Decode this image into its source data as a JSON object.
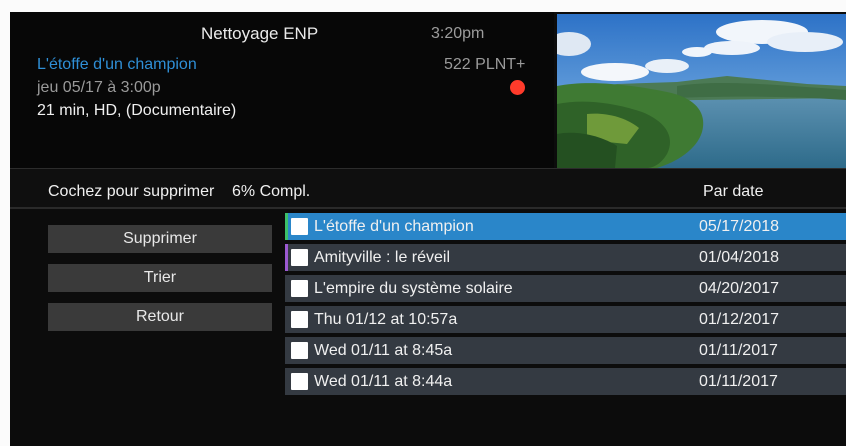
{
  "header": {
    "title": "Nettoyage ENP",
    "time": "3:20pm"
  },
  "program": {
    "title": "L'étoffe d'un champion",
    "airing": "jeu 05/17 à 3:00p",
    "details": "21 min, HD, (Documentaire)",
    "channel": "522 PLNT+",
    "recording_indicator_color": "#ff3b2b"
  },
  "status": {
    "instruction": "Cochez pour supprimer",
    "completion": "6% Compl.",
    "sort": "Par date"
  },
  "menu": {
    "delete_label": "Supprimer",
    "sort_label": "Trier",
    "back_label": "Retour"
  },
  "recordings": [
    {
      "name": "L'étoffe d'un champion",
      "date": "05/17/2018",
      "checked": false,
      "selected": true,
      "flag_color": "#3cc06a"
    },
    {
      "name": "Amityville : le réveil",
      "date": "01/04/2018",
      "checked": false,
      "selected": false,
      "flag_color": "#9b59d0"
    },
    {
      "name": "L'empire du système solaire",
      "date": "04/20/2017",
      "checked": false,
      "selected": false,
      "flag_color": ""
    },
    {
      "name": "Thu 01/12 at 10:57a",
      "date": "01/12/2017",
      "checked": false,
      "selected": false,
      "flag_color": ""
    },
    {
      "name": "Wed 01/11 at 8:45a",
      "date": "01/11/2017",
      "checked": false,
      "selected": false,
      "flag_color": ""
    },
    {
      "name": "Wed 01/11 at 8:44a",
      "date": "01/11/2017",
      "checked": false,
      "selected": false,
      "flag_color": ""
    }
  ],
  "colors": {
    "accent": "#2a86c9",
    "title_text": "#2f8fd6",
    "row_background": "#343a42",
    "button_background": "#3a3a3a"
  }
}
